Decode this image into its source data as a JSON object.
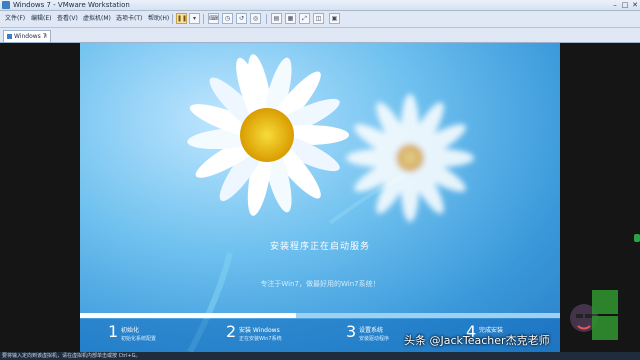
{
  "window": {
    "title": "Windows 7 - VMware Workstation"
  },
  "menu": {
    "items": [
      "文件(F)",
      "编辑(E)",
      "查看(V)",
      "虚拟机(M)",
      "选项卡(T)",
      "帮助(H)"
    ]
  },
  "tabs": [
    {
      "label": "Windows 7"
    }
  ],
  "guest": {
    "status_message": "安装程序正在启动服务",
    "tagline": "专注于Win7，做最好用的Win7系统！",
    "progress": 0.45,
    "steps": [
      {
        "number": "1",
        "title": "初始化",
        "desc": "初始化系统配置"
      },
      {
        "number": "2",
        "title": "安装 Windows",
        "desc": "正在安装Win7系统"
      },
      {
        "number": "3",
        "title": "设置系统",
        "desc": "安装驱动程序"
      },
      {
        "number": "4",
        "title": "完成安装",
        "desc": ""
      }
    ]
  },
  "statusbar": {
    "text": "要将输入定向到该虚拟机，请在虚拟机内部单击或按 Ctrl+G。"
  },
  "watermark": {
    "text": "头条 @JackTeacher杰克老师"
  },
  "colors": {
    "accent": "#3a98da",
    "progress_fill": "#ffffff",
    "petal": "#ffffff",
    "center": "#f2c400"
  }
}
